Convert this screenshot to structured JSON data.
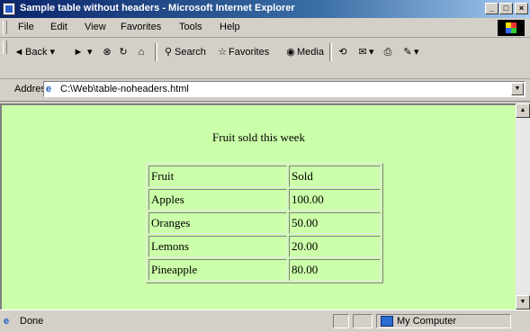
{
  "window": {
    "title": "Sample table without headers - Microsoft Internet Explorer",
    "minimize": "_",
    "maximize": "□",
    "close": "×"
  },
  "menu": [
    "File",
    "Edit",
    "View",
    "Favorites",
    "Tools",
    "Help"
  ],
  "toolbar": {
    "back": "Back",
    "search": "Search",
    "favorites": "Favorites",
    "media": "Media"
  },
  "address": {
    "label": "Address",
    "url": "C:\\Web\\table-noheaders.html"
  },
  "page": {
    "caption": "Fruit sold this week",
    "headers": [
      "Fruit",
      "Sold"
    ],
    "rows": [
      [
        "Apples",
        "100.00"
      ],
      [
        "Oranges",
        "50.00"
      ],
      [
        "Lemons",
        "20.00"
      ],
      [
        "Pineapple",
        "80.00"
      ]
    ]
  },
  "status": {
    "text": "Done",
    "zone": "My Computer"
  }
}
